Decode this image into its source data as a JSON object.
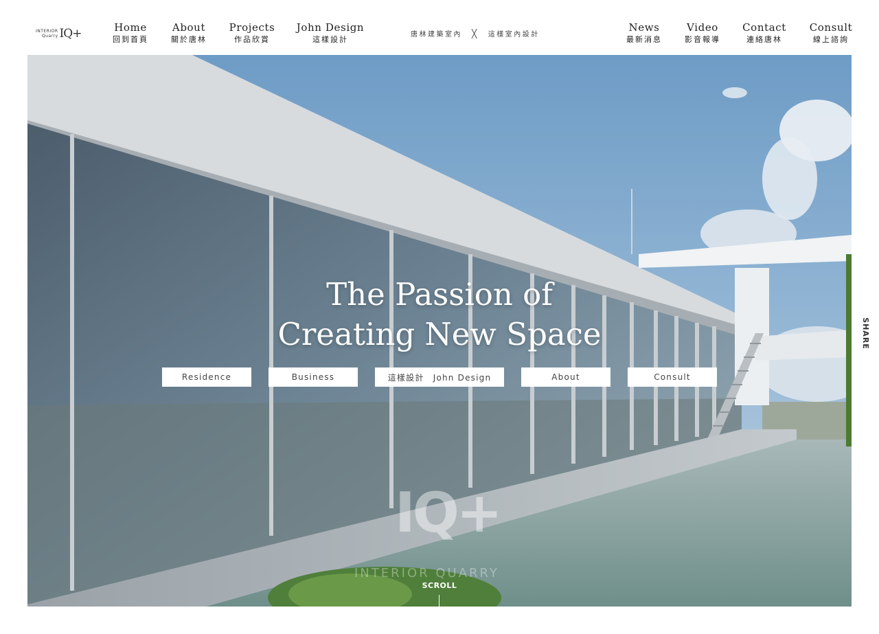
{
  "logo": {
    "line1": "INTERIOR",
    "line2": "Quarry",
    "mark": "IQ+"
  },
  "nav_left": [
    {
      "en": "Home",
      "zh": "回到首頁"
    },
    {
      "en": "About",
      "zh": "關於唐林"
    },
    {
      "en": "Projects",
      "zh": "作品欣賞"
    },
    {
      "en": "John Design",
      "zh": "這樣設計"
    }
  ],
  "brand_center": {
    "left": "唐林建築室內",
    "separator": "╳",
    "right": "這樣室內設計"
  },
  "nav_right": [
    {
      "en": "News",
      "zh": "最新消息"
    },
    {
      "en": "Video",
      "zh": "影音報導"
    },
    {
      "en": "Contact",
      "zh": "連絡唐林"
    },
    {
      "en": "Consult",
      "zh": "線上諮詢"
    }
  ],
  "hero": {
    "title_line1": "The Passion of",
    "title_line2": "Creating New Space",
    "buttons": [
      "Residence",
      "Business",
      "這樣設計　John Design",
      "About",
      "Consult"
    ],
    "watermark_mark": "IQ+",
    "watermark_text": "INTERIOR QUARRY",
    "scroll_label": "SCROLL"
  },
  "share_label": "SHARE",
  "colors": {
    "header_bg": "#ffffff",
    "text": "#222222",
    "button_bg": "#ffffff",
    "sky": "#7fa9cc",
    "water": "#7d9a98"
  }
}
